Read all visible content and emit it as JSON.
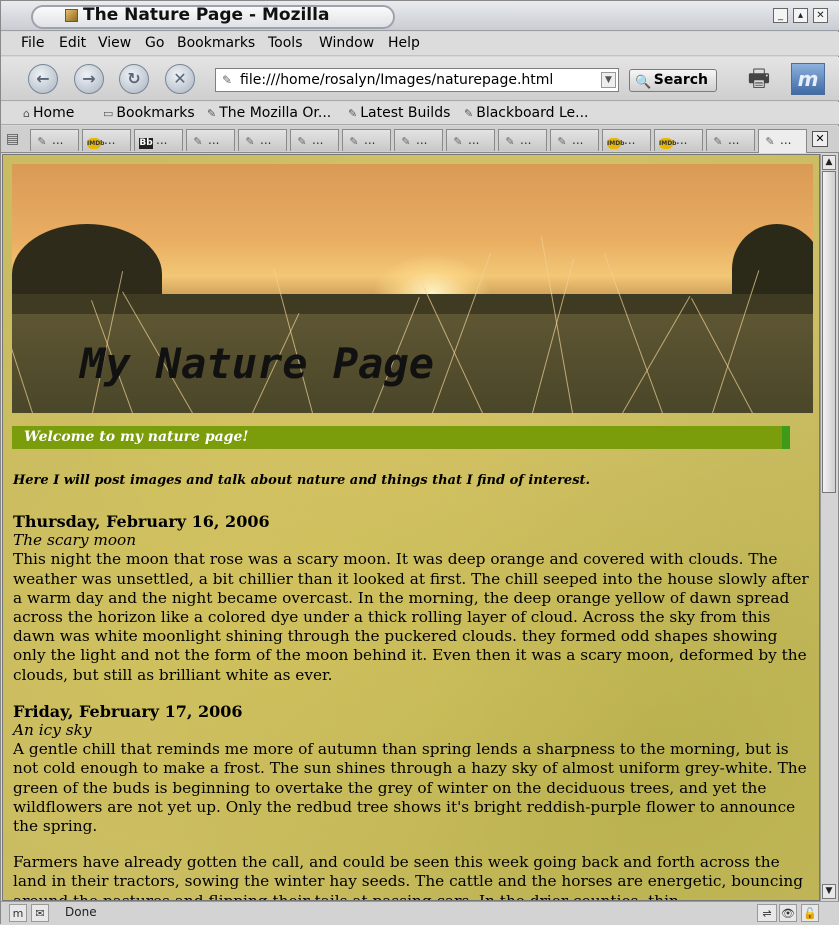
{
  "window": {
    "title": "The Nature Page - Mozilla"
  },
  "menu": [
    "File",
    "Edit",
    "View",
    "Go",
    "Bookmarks",
    "Tools",
    "Window",
    "Help"
  ],
  "nav": {
    "url": "file:///home/rosalyn/Images/naturepage.html",
    "search_label": "Search"
  },
  "bookmarks": [
    "Home",
    "Bookmarks",
    "The Mozilla Or...",
    "Latest Builds",
    "Blackboard Le..."
  ],
  "tabs": [
    {
      "label": "...",
      "icon": "page-icon"
    },
    {
      "label": "...",
      "icon": "imdb-icon",
      "badge": "IMDb"
    },
    {
      "label": "...",
      "icon": "blackboard-icon",
      "badge": "Bb"
    },
    {
      "label": "...",
      "icon": "page-icon"
    },
    {
      "label": "...",
      "icon": "page-icon"
    },
    {
      "label": "...",
      "icon": "page-icon"
    },
    {
      "label": "...",
      "icon": "page-icon"
    },
    {
      "label": "...",
      "icon": "page-icon"
    },
    {
      "label": "...",
      "icon": "page-icon"
    },
    {
      "label": "...",
      "icon": "page-icon"
    },
    {
      "label": "...",
      "icon": "page-icon"
    },
    {
      "label": "...",
      "icon": "imdb-icon",
      "badge": "IMDb"
    },
    {
      "label": "...",
      "icon": "imdb-icon",
      "badge": "IMDb"
    },
    {
      "label": "...",
      "icon": "page-icon"
    },
    {
      "label": "...",
      "icon": "page-icon"
    }
  ],
  "page": {
    "banner_title": "My Nature Page",
    "welcome": "Welcome to my nature page!",
    "intro": "Here I will post images and talk about nature and things that I find of interest.",
    "posts": [
      {
        "date": "Thursday, February 16, 2006",
        "subtitle": "The scary moon",
        "paragraphs": [
          "This night the moon that rose was a scary moon. It was deep orange and covered with clouds. The weather was unsettled, a bit chillier than it looked at first. The chill seeped into the house slowly after a warm day and the night became overcast. In the morning, the deep orange yellow of dawn spread across the horizon like a colored dye under a thick rolling layer of cloud. Across the sky from this dawn was white moonlight shining through the puckered clouds. they formed odd shapes showing only the light and not the form of the moon behind it. Even then it was a scary moon, deformed by the clouds, but still as brilliant white as ever."
        ]
      },
      {
        "date": "Friday, February 17, 2006",
        "subtitle": "An icy sky",
        "paragraphs": [
          "A gentle chill that reminds me more of autumn than spring lends a sharpness to the morning, but is not cold enough to make a frost. The sun shines through a hazy sky of almost uniform grey-white. The green of the buds is beginning to overtake the grey of winter on the deciduous trees, and yet the wildflowers are not yet up. Only the redbud tree shows it's bright reddish-purple flower to announce the spring.",
          "Farmers have already gotten the call, and could be seen this week going back and forth across the land in their tractors, sowing the winter hay seeds. The cattle and the horses are energetic, bouncing around the pastures and flipping their tails at passing cars. In the drier counties, thin"
        ]
      }
    ]
  },
  "status": {
    "text": "Done"
  }
}
